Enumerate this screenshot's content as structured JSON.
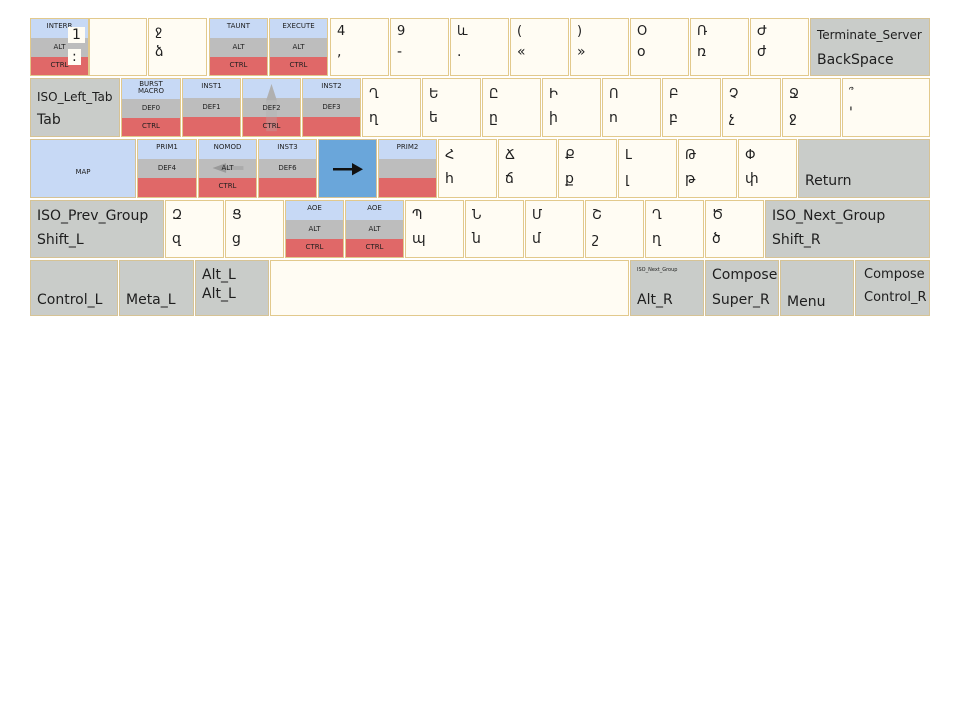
{
  "row1": {
    "interr": {
      "top": "INTERR",
      "mid": "ALT",
      "bot": "CTRL",
      "c1": "1",
      "c2": ":"
    },
    "k2": {
      "upper": "ջ",
      "lower": "ձ"
    },
    "taunt": {
      "top": "TAUNT",
      "mid": "ALT",
      "bot": "CTRL"
    },
    "execute": {
      "top": "EXECUTE",
      "mid": "ALT",
      "bot": "CTRL"
    },
    "k4": {
      "upper": "4",
      "lower": ","
    },
    "k5": {
      "upper": "9",
      "lower": "-"
    },
    "k6": {
      "upper": "և",
      "lower": "."
    },
    "k7": {
      "upper": "(",
      "lower": "«"
    },
    "k8": {
      "upper": ")",
      "lower": "»"
    },
    "k9": {
      "upper": "Օ",
      "lower": "օ"
    },
    "k10": {
      "upper": "Ռ",
      "lower": "ռ"
    },
    "k11": {
      "upper": "Ժ",
      "lower": "ժ"
    },
    "backspace": {
      "top": "Terminate_Server",
      "bottom": "BackSpace"
    }
  },
  "row2": {
    "tab": {
      "top": "ISO_Left_Tab",
      "bottom": "Tab"
    },
    "burst": {
      "top1": "BURST",
      "top2": "MACRO",
      "mid": "DEF0",
      "bot": "CTRL"
    },
    "inst1": {
      "top": "INST1",
      "mid": "DEF1",
      "bot": ""
    },
    "def2": {
      "mid": "DEF2",
      "bot": "CTRL"
    },
    "inst2": {
      "top": "INST2",
      "mid": "DEF3",
      "bot": ""
    },
    "k1": {
      "upper": "Ղ",
      "lower": "ղ"
    },
    "k2": {
      "upper": "Ե",
      "lower": "ե"
    },
    "k3": {
      "upper": "Ը",
      "lower": "ը"
    },
    "k4": {
      "upper": "Ի",
      "lower": "ի"
    },
    "k5": {
      "upper": "Ո",
      "lower": "ո"
    },
    "k6": {
      "upper": "Բ",
      "lower": "բ"
    },
    "k7": {
      "upper": "Չ",
      "lower": "չ"
    },
    "k8": {
      "upper": "Ջ",
      "lower": "ջ"
    },
    "k9": {
      "upper": "՞",
      "lower": "'"
    }
  },
  "row3": {
    "map": {
      "label": "MAP"
    },
    "prim1": {
      "top": "PRIM1",
      "mid": "DEF4",
      "bot": ""
    },
    "nomod": {
      "top": "NOMOD",
      "mid": "ALT",
      "bot": "CTRL"
    },
    "inst3": {
      "top": "INST3",
      "mid": "DEF6",
      "bot": ""
    },
    "prim2": {
      "top": "PRIM2",
      "mid": "",
      "bot": ""
    },
    "k1": {
      "upper": "Հ",
      "lower": "հ"
    },
    "k2": {
      "upper": "Ճ",
      "lower": "ճ"
    },
    "k3": {
      "upper": "Ք",
      "lower": "ք"
    },
    "k4": {
      "upper": "Լ",
      "lower": "լ"
    },
    "k5": {
      "upper": "Թ",
      "lower": "թ"
    },
    "k6": {
      "upper": "Փ",
      "lower": "փ"
    },
    "return": {
      "label": "Return"
    }
  },
  "row4": {
    "shiftl": {
      "top": "ISO_Prev_Group",
      "bottom": "Shift_L"
    },
    "k1": {
      "upper": "Զ",
      "lower": "զ"
    },
    "k2": {
      "upper": "Ց",
      "lower": "ց"
    },
    "aoe1": {
      "top": "AOE",
      "mid": "ALT",
      "bot": "CTRL"
    },
    "aoe2": {
      "top": "AOE",
      "mid": "ALT",
      "bot": "CTRL"
    },
    "k3": {
      "upper": "Պ",
      "lower": "պ"
    },
    "k4": {
      "upper": "Ն",
      "lower": "ն"
    },
    "k5": {
      "upper": "Մ",
      "lower": "մ"
    },
    "k6": {
      "upper": "Շ",
      "lower": "շ"
    },
    "k7": {
      "upper": "Ղ",
      "lower": "ղ"
    },
    "k8": {
      "upper": "Ծ",
      "lower": "ծ"
    },
    "shiftr": {
      "top": "ISO_Next_Group",
      "bottom": "Shift_R"
    }
  },
  "row5": {
    "controll": {
      "label": "Control_L"
    },
    "metal": {
      "label": "Meta_L"
    },
    "altl": {
      "top": "Alt_L",
      "bottom": "Alt_L"
    },
    "altr": {
      "top": "ISO_Next_Group",
      "bottom": "Alt_R"
    },
    "superr": {
      "top": "Compose",
      "bottom": "Super_R"
    },
    "menu": {
      "label": "Menu"
    },
    "controlr": {
      "top": "Compose",
      "bottom": "Control_R"
    }
  }
}
